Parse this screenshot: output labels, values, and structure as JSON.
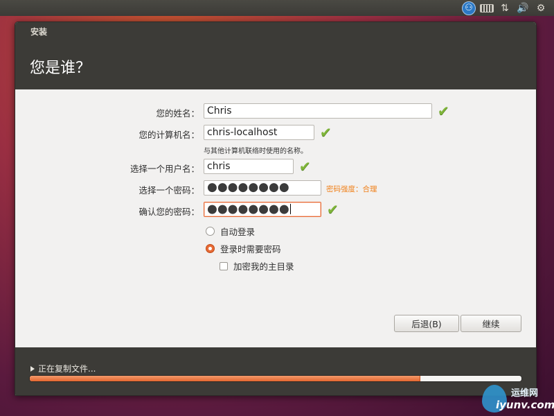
{
  "top_panel": {
    "accessibility_icon": "accessibility-icon",
    "keyboard_icon": "keyboard-icon",
    "network_icon": "network-arrows-icon",
    "sound_icon": "volume-icon",
    "settings_icon": "gear-icon"
  },
  "window": {
    "title": "安装",
    "heading": "您是谁？"
  },
  "form": {
    "name": {
      "label": "您的姓名：",
      "value": "Chris"
    },
    "computer_name": {
      "label": "您的计算机名：",
      "value": "chris-localhost",
      "hint": "与其他计算机联络时使用的名称。"
    },
    "username": {
      "label": "选择一个用户名：",
      "value": "chris"
    },
    "password": {
      "label": "选择一个密码：",
      "value": "●●●●●●●●",
      "strength": "密码强度：合理"
    },
    "confirm_password": {
      "label": "确认您的密码：",
      "value": "●●●●●●●●"
    },
    "auto_login_label": "自动登录",
    "require_password_label": "登录时需要密码",
    "encrypt_home_label": "加密我的主目录",
    "selected_login_option": "require_password",
    "encrypt_home_checked": false
  },
  "buttons": {
    "back": "后退(B)",
    "continue": "继续"
  },
  "progress": {
    "label": "正在复制文件...",
    "fraction": 0.795
  },
  "watermark": {
    "text": "运维网",
    "url": "iyunv.com"
  },
  "colors": {
    "accent": "#e86b36",
    "check": "#7fb53a",
    "strength": "#f08019",
    "header": "#3c3b37"
  }
}
